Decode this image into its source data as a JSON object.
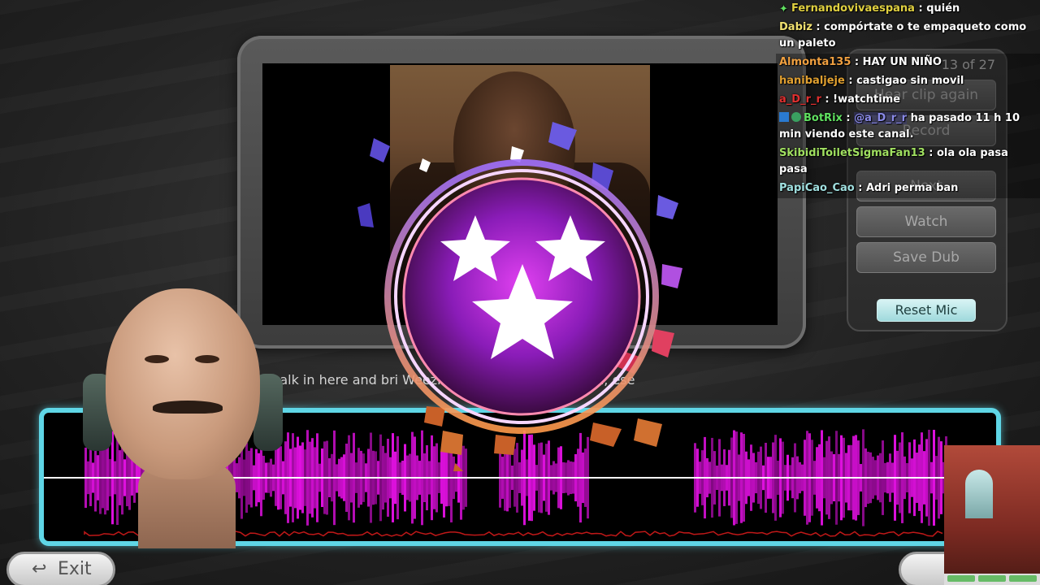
{
  "player": {
    "subtitle": "u walk in here and bri                     Weezing) That's a brilliant plan, ese",
    "clip_counter": "13 of 27"
  },
  "side_panel": {
    "buttons": [
      {
        "label": "Hear clip again"
      },
      {
        "label": "Record"
      },
      {
        "label": "Next"
      },
      {
        "label": "Watch"
      },
      {
        "label": "Save Dub"
      }
    ],
    "reset_mic_label": "Reset Mic"
  },
  "bottom": {
    "exit_label": "Exit"
  },
  "colors": {
    "accent_cyan": "#5fd6e6",
    "waveform_magenta": "#e010e0",
    "badge_purple": "#7a2cc8",
    "badge_orange": "#e07a3a"
  },
  "badge": {
    "icon": "three-stars-icon"
  },
  "chat": {
    "messages": [
      {
        "user": "Fernandovivaespana",
        "color": "#e0d040",
        "text": "quién",
        "badge": "star-badge-icon"
      },
      {
        "user": "Dabiz",
        "color": "#f0e070",
        "text": "compórtate o te empaqueto como un paleto"
      },
      {
        "user": "Almonta135",
        "color": "#f0a040",
        "text": "HAY UN NIÑO"
      },
      {
        "user": "hanibaljeje",
        "color": "#e0a030",
        "text": "castigao sin movil"
      },
      {
        "user": "a_D_r_r",
        "color": "#e03030",
        "text": "!watchtime"
      },
      {
        "user": "BotRix",
        "color": "#60e060",
        "mention": "@a_D_r_r",
        "text": "ha pasado 11 h 10 min viendo este canal.",
        "badge": "bot-badge-icon"
      },
      {
        "user": "SkibidiToiletSigmaFan13",
        "color": "#a0e060",
        "text": "ola ola pasa pasa"
      },
      {
        "user": "PapiCao_Cao",
        "color": "#a0e0e0",
        "text": "Adri perma ban"
      }
    ]
  }
}
